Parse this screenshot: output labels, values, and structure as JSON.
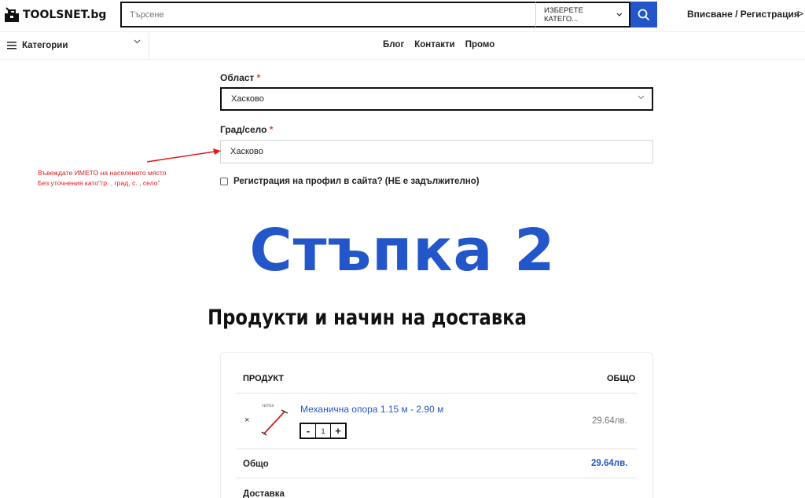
{
  "header": {
    "logo_text": "TOOLSNET.bg",
    "search_placeholder": "Търсене",
    "category_select": "ИЗБЕРЕТЕ КАТЕГО...",
    "login": "Вписване / Регистрация",
    "login_arrow": ">"
  },
  "nav": {
    "categories_label": "Категории",
    "links": [
      "Блог",
      "Контакти",
      "Промо"
    ]
  },
  "form": {
    "region_label": "Област",
    "region_required": "*",
    "region_value": "Хасково",
    "city_label": "Град/село",
    "city_required": "*",
    "city_value": "Хасково",
    "register_label": "Регистрация на профил в сайта? (НЕ е задължително)"
  },
  "annotation": {
    "line1": "Въвеждате ИМЕТО на населеното място",
    "line2": "Без уточнения като\"гр. , град, с. , село\"",
    "color": "#e0191b"
  },
  "step_title": "Стъпка 2",
  "section_title": "Продукти и начин на доставка",
  "order": {
    "col_product": "ПРОДУКТ",
    "col_total": "ОБЩО",
    "remove": "×",
    "product_name": "Механична опора 1.15 м - 2.90 м",
    "qty_minus": "-",
    "qty_value": "1",
    "qty_plus": "+",
    "price": "29.64лв.",
    "total_label": "Общо",
    "total_value": "29.64лв.",
    "shipping_label": "Доставка"
  },
  "colors": {
    "accent": "#2356c8",
    "required": "#e2401c"
  }
}
